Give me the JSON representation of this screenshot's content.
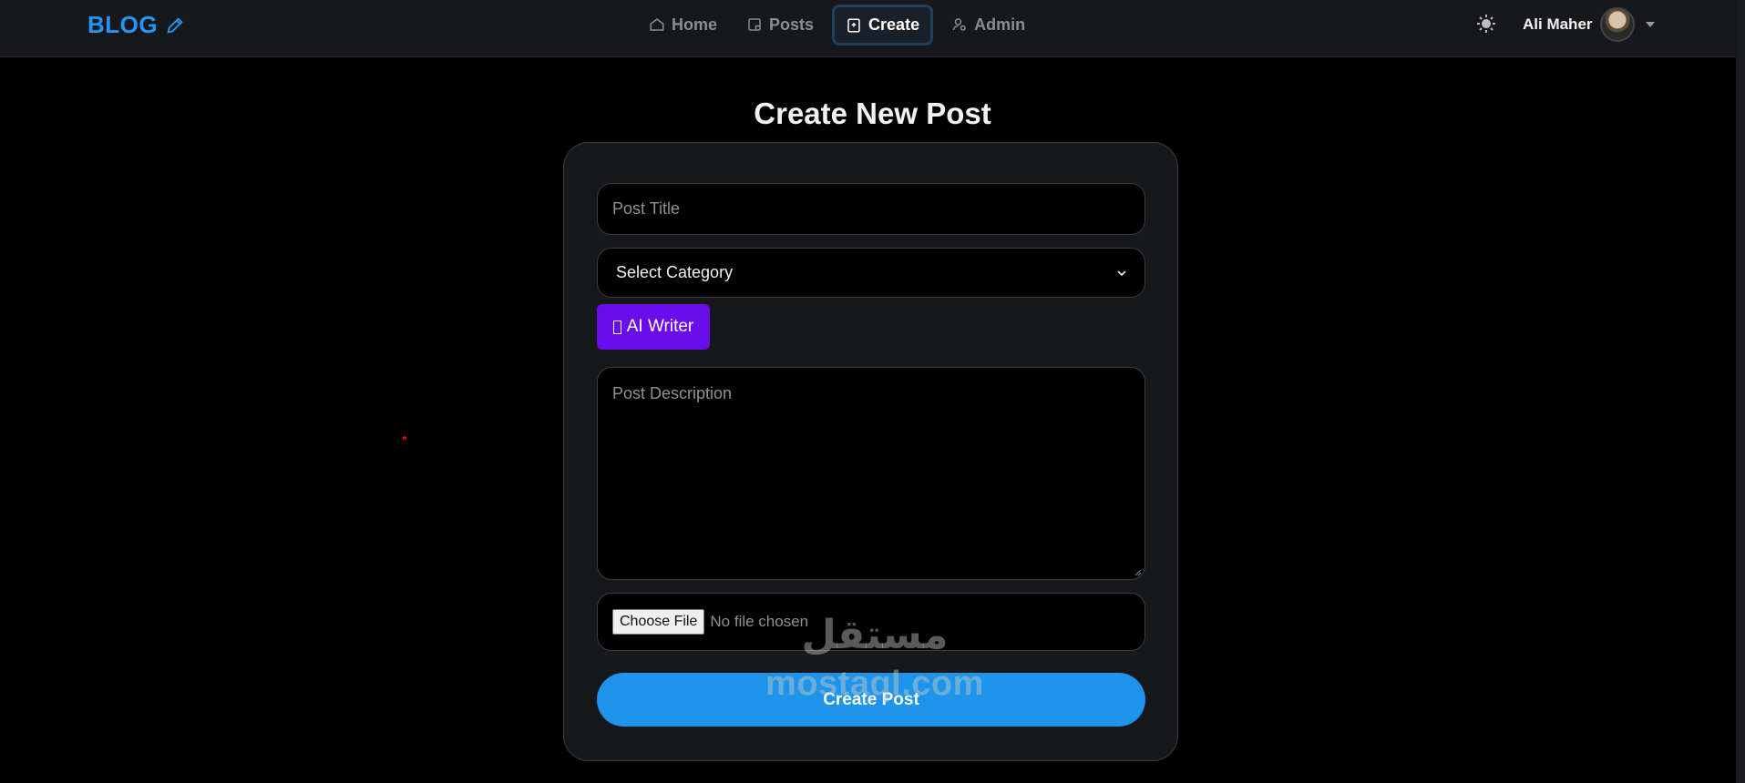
{
  "brand": {
    "label": "BLOG",
    "icon": "pencil-icon",
    "color": "#2196f3"
  },
  "nav": {
    "items": [
      {
        "label": "Home",
        "icon": "home-icon"
      },
      {
        "label": "Posts",
        "icon": "posts-icon"
      },
      {
        "label": "Create",
        "icon": "create-icon",
        "active": true
      },
      {
        "label": "Admin",
        "icon": "admin-icon"
      }
    ]
  },
  "header": {
    "theme_icon": "sun-icon",
    "user_name": "Ali Maher"
  },
  "page": {
    "title": "Create New Post"
  },
  "form": {
    "title_placeholder": "Post Title",
    "category_selected": "Select Category",
    "ai_button": "AI Writer",
    "description_placeholder": "Post Description",
    "file_button": "Choose File",
    "file_status": "No file chosen",
    "submit_label": "Create Post"
  },
  "watermark": {
    "arabic": "مستقل",
    "latin": "mostaql.com"
  },
  "colors": {
    "accent": "#1e95ea",
    "ai_button": "#6a0dea",
    "background": "#000000",
    "card": "#17181c"
  }
}
